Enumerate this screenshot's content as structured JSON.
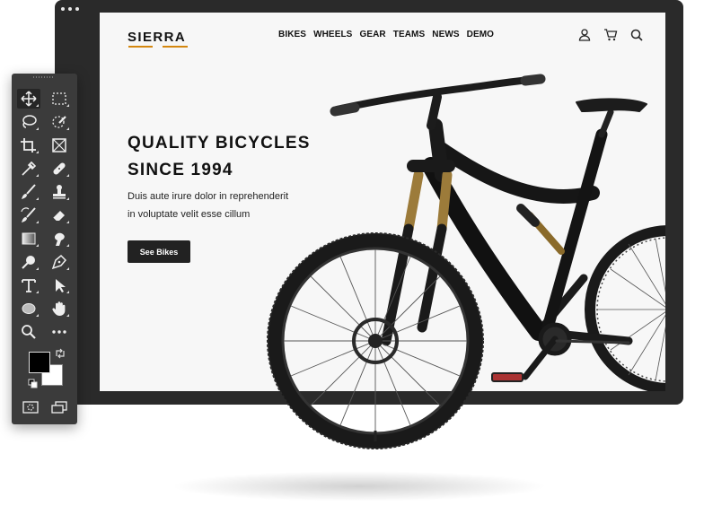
{
  "site": {
    "logo": "SIERRA",
    "nav": [
      "BIKES",
      "WHEELS",
      "GEAR",
      "TEAMS",
      "NEWS",
      "DEMO"
    ],
    "header_icons": [
      "user-icon",
      "cart-icon",
      "search-icon"
    ],
    "accent_color": "#d4870f"
  },
  "hero": {
    "title_lines": [
      "QUALITY BICYCLES",
      "SINCE 1994"
    ],
    "body_lines": [
      "Duis aute irure dolor in reprehenderit",
      "in voluptate velit esse cillum"
    ],
    "button": "See Bikes"
  },
  "toolbar": {
    "tools": [
      "move-icon",
      "marquee-icon",
      "lasso-icon",
      "quick-select-icon",
      "crop-icon",
      "frame-icon",
      "eyedropper-icon",
      "healing-icon",
      "brush-icon",
      "stamp-icon",
      "history-brush-icon",
      "eraser-icon",
      "gradient-icon",
      "smudge-icon",
      "dodge-icon",
      "pen-icon",
      "type-icon",
      "path-select-icon",
      "ellipse-icon",
      "hand-icon",
      "zoom-icon",
      "more-icon"
    ],
    "foreground_color": "#000000",
    "background_color": "#ffffff"
  }
}
